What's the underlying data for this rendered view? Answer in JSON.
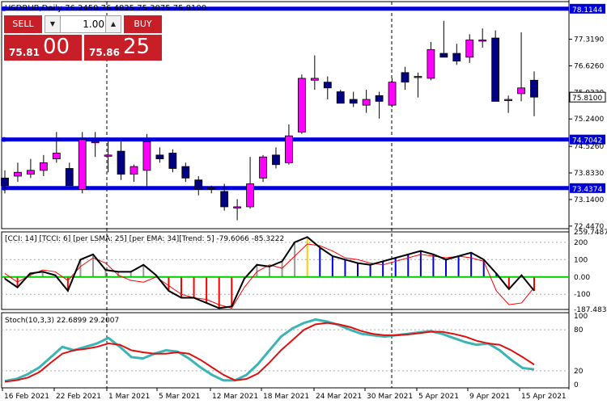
{
  "symbol_header": "USDRUB,Daily  76.2450 76.4825 75.3075 75.8100",
  "trade_panel": {
    "sell_label": "SELL",
    "buy_label": "BUY",
    "volume": "1.00",
    "sell_price_small": "75.81",
    "sell_price_big": "00",
    "buy_price_small": "75.86",
    "buy_price_big": "25"
  },
  "price_axis_ticks": [
    "77.3190",
    "76.6260",
    "75.9330",
    "75.2400",
    "74.5260",
    "73.8330",
    "73.1400",
    "72.4470"
  ],
  "price_axis_ticks_values": [
    77.319,
    76.626,
    75.933,
    75.24,
    74.526,
    73.833,
    73.14,
    72.447
  ],
  "level_lines": [
    {
      "value": 78.1144,
      "label": "78.1144"
    },
    {
      "value": 74.7042,
      "label": "74.7042"
    },
    {
      "value": 73.4374,
      "label": "73.4374"
    }
  ],
  "current_price_label": "75.8100",
  "current_price_value": 75.81,
  "cci_header": "[CCI: 14] [TCCI: 6] [per LSMA: 25] [per EMA: 34][Trend: 5]  -79.6066 -85.3222",
  "cci_axis_ticks": [
    "259.7487",
    "200",
    "100",
    "0.00",
    "-100",
    "-187.4837"
  ],
  "cci_axis_values": [
    259.7487,
    200,
    100,
    0,
    -100,
    -187.4837
  ],
  "stoch_header": "Stoch(10,3,3) 22.6899 29.2007",
  "stoch_axis_ticks": [
    "100",
    "80",
    "20",
    "0"
  ],
  "stoch_axis_values": [
    100,
    80,
    20,
    0
  ],
  "date_labels": [
    "16 Feb 2021",
    "22 Feb 2021",
    "1 Mar 2021",
    "5 Mar 2021",
    "12 Mar 2021",
    "18 Mar 2021",
    "24 Mar 2021",
    "30 Mar 2021",
    "5 Apr 2021",
    "9 Apr 2021",
    "15 Apr 2021"
  ],
  "colors": {
    "bull": "#ff00ff",
    "bear": "#000080",
    "level": "#0000dd",
    "cci_main": "#000000",
    "cci_thin": "#ff0000",
    "cci_zero_green": "#00cc00",
    "hist_red": "#ff0000",
    "hist_blue": "#0000dd",
    "hist_gray": "#999999",
    "hist_yellow": "#ffcc00",
    "stoch_main": "#3cb4b4",
    "stoch_signal": "#e01010"
  },
  "chart_data": [
    {
      "type": "candlestick",
      "title": "USDRUB,Daily",
      "ylim": [
        72.38,
        78.3
      ],
      "candles": [
        {
          "o": 73.7,
          "h": 73.9,
          "l": 73.3,
          "c": 73.5
        },
        {
          "o": 73.75,
          "h": 74.1,
          "l": 73.6,
          "c": 73.85
        },
        {
          "o": 73.8,
          "h": 74.2,
          "l": 73.7,
          "c": 73.9
        },
        {
          "o": 73.9,
          "h": 74.3,
          "l": 73.75,
          "c": 74.1
        },
        {
          "o": 74.2,
          "h": 74.9,
          "l": 74.1,
          "c": 74.35
        },
        {
          "o": 73.95,
          "h": 74.1,
          "l": 73.55,
          "c": 73.5
        },
        {
          "o": 73.4,
          "h": 74.9,
          "l": 73.3,
          "c": 74.7
        },
        {
          "o": 74.65,
          "h": 74.9,
          "l": 74.25,
          "c": 74.65
        },
        {
          "o": 74.3,
          "h": 74.75,
          "l": 73.85,
          "c": 74.3
        },
        {
          "o": 74.4,
          "h": 74.65,
          "l": 73.65,
          "c": 73.8
        },
        {
          "o": 73.8,
          "h": 74.05,
          "l": 73.6,
          "c": 74.0
        },
        {
          "o": 73.9,
          "h": 74.85,
          "l": 73.4,
          "c": 74.65
        },
        {
          "o": 74.3,
          "h": 74.5,
          "l": 74.1,
          "c": 74.2
        },
        {
          "o": 74.35,
          "h": 74.45,
          "l": 73.85,
          "c": 73.95
        },
        {
          "o": 74.0,
          "h": 74.1,
          "l": 73.6,
          "c": 73.7
        },
        {
          "o": 73.65,
          "h": 73.75,
          "l": 73.25,
          "c": 73.4
        },
        {
          "o": 73.45,
          "h": 73.5,
          "l": 73.3,
          "c": 73.4
        },
        {
          "o": 73.35,
          "h": 73.55,
          "l": 72.85,
          "c": 72.95
        },
        {
          "o": 72.95,
          "h": 73.15,
          "l": 72.6,
          "c": 72.95
        },
        {
          "o": 72.95,
          "h": 74.25,
          "l": 72.9,
          "c": 73.55
        },
        {
          "o": 73.7,
          "h": 74.3,
          "l": 73.6,
          "c": 74.25
        },
        {
          "o": 74.3,
          "h": 74.5,
          "l": 73.95,
          "c": 74.05
        },
        {
          "o": 74.1,
          "h": 75.1,
          "l": 74.05,
          "c": 74.8
        },
        {
          "o": 74.9,
          "h": 76.4,
          "l": 74.85,
          "c": 76.3
        },
        {
          "o": 76.25,
          "h": 76.9,
          "l": 76.0,
          "c": 76.3
        },
        {
          "o": 76.2,
          "h": 76.35,
          "l": 75.75,
          "c": 76.05
        },
        {
          "o": 75.95,
          "h": 76.0,
          "l": 75.65,
          "c": 75.65
        },
        {
          "o": 75.75,
          "h": 75.95,
          "l": 75.55,
          "c": 75.65
        },
        {
          "o": 75.6,
          "h": 76.0,
          "l": 75.4,
          "c": 75.75
        },
        {
          "o": 75.85,
          "h": 75.95,
          "l": 75.25,
          "c": 75.7
        },
        {
          "o": 75.6,
          "h": 76.3,
          "l": 75.55,
          "c": 76.2
        },
        {
          "o": 76.45,
          "h": 76.6,
          "l": 76.0,
          "c": 76.2
        },
        {
          "o": 76.35,
          "h": 76.45,
          "l": 75.8,
          "c": 76.35
        },
        {
          "o": 76.3,
          "h": 77.25,
          "l": 76.25,
          "c": 77.05
        },
        {
          "o": 76.95,
          "h": 77.8,
          "l": 76.85,
          "c": 76.85
        },
        {
          "o": 76.95,
          "h": 77.2,
          "l": 76.65,
          "c": 76.75
        },
        {
          "o": 76.85,
          "h": 77.45,
          "l": 76.7,
          "c": 77.3
        },
        {
          "o": 77.3,
          "h": 77.6,
          "l": 77.1,
          "c": 77.3
        },
        {
          "o": 77.35,
          "h": 77.55,
          "l": 75.7,
          "c": 75.7
        },
        {
          "o": 75.75,
          "h": 75.85,
          "l": 75.4,
          "c": 75.75
        },
        {
          "o": 75.9,
          "h": 77.5,
          "l": 75.7,
          "c": 76.05
        },
        {
          "o": 76.25,
          "h": 76.48,
          "l": 75.31,
          "c": 75.81
        }
      ]
    },
    {
      "type": "line",
      "title": "CCI",
      "ylim": [
        -187.4837,
        259.7487
      ],
      "series": [
        {
          "name": "CCI",
          "values": [
            -10,
            -60,
            20,
            30,
            10,
            -80,
            100,
            130,
            40,
            30,
            30,
            70,
            10,
            -80,
            -120,
            -120,
            -150,
            -180,
            -170,
            -10,
            70,
            60,
            90,
            200,
            230,
            170,
            120,
            100,
            80,
            70,
            90,
            110,
            130,
            150,
            130,
            100,
            120,
            140,
            100,
            20,
            -70,
            10,
            -80
          ]
        },
        {
          "name": "TCCI",
          "values": [
            20,
            -30,
            10,
            40,
            30,
            -20,
            60,
            110,
            80,
            10,
            -20,
            -30,
            0,
            -50,
            -100,
            -120,
            -130,
            -160,
            -180,
            -60,
            30,
            70,
            50,
            120,
            190,
            180,
            150,
            110,
            100,
            80,
            70,
            90,
            110,
            130,
            120,
            110,
            120,
            110,
            90,
            -80,
            -160,
            -150,
            -60
          ]
        }
      ]
    },
    {
      "type": "line",
      "title": "Stoch(10,3,3)",
      "ylim": [
        -5,
        105
      ],
      "series": [
        {
          "name": "Main",
          "values": [
            5,
            8,
            15,
            25,
            40,
            55,
            50,
            55,
            60,
            68,
            55,
            40,
            38,
            45,
            50,
            48,
            38,
            25,
            14,
            6,
            6,
            14,
            30,
            50,
            70,
            82,
            90,
            95,
            92,
            87,
            80,
            74,
            72,
            70,
            72,
            74,
            76,
            78,
            74,
            68,
            62,
            58,
            60,
            50,
            36,
            24,
            22
          ]
        },
        {
          "name": "Signal",
          "values": [
            4,
            6,
            10,
            18,
            32,
            45,
            50,
            52,
            55,
            60,
            58,
            50,
            47,
            45,
            45,
            47,
            45,
            36,
            25,
            14,
            6,
            8,
            16,
            32,
            50,
            65,
            80,
            88,
            90,
            88,
            84,
            78,
            74,
            72,
            72,
            73,
            75,
            77,
            77,
            74,
            70,
            64,
            60,
            58,
            50,
            40,
            29
          ]
        }
      ]
    }
  ]
}
